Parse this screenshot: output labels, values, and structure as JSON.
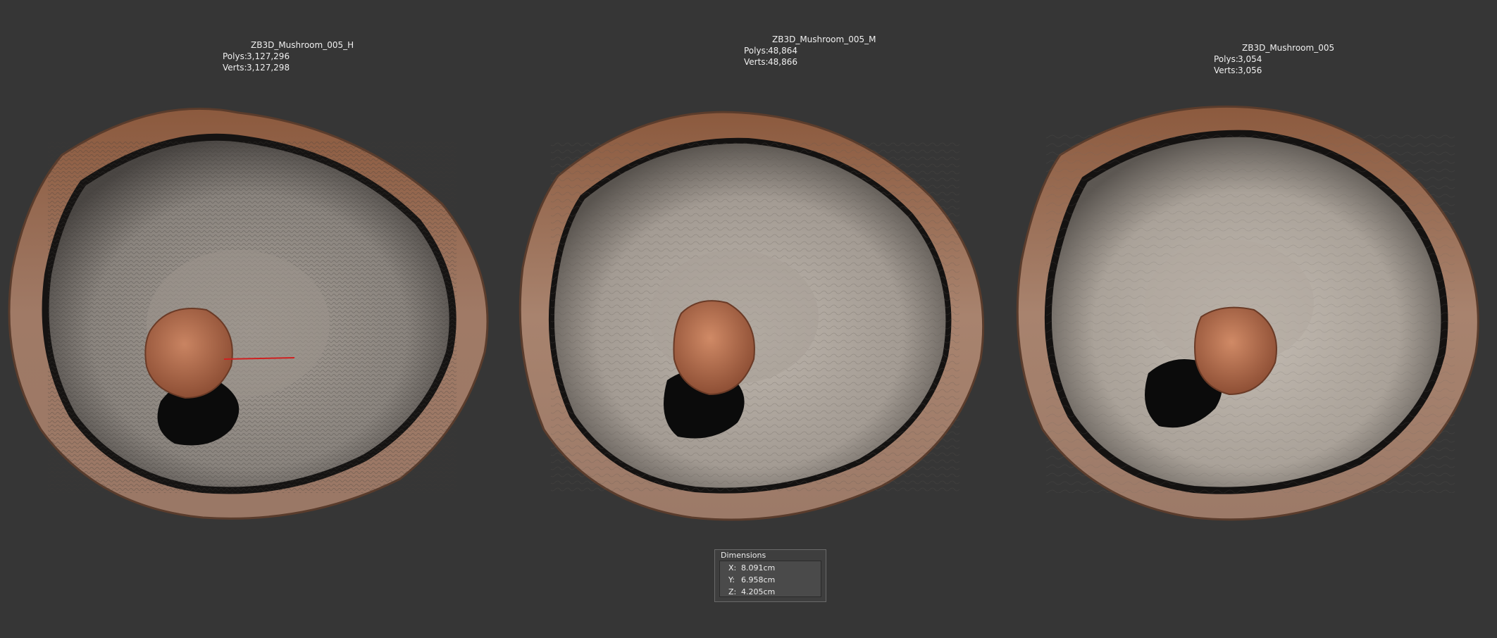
{
  "models": [
    {
      "name": "ZB3D_Mushroom_005_H",
      "polys_label": "Polys:",
      "polys": "3,127,296",
      "verts_label": "Verts:",
      "verts": "3,127,298"
    },
    {
      "name": "ZB3D_Mushroom_005_M",
      "polys_label": "Polys:",
      "polys": "48,864",
      "verts_label": "Verts:",
      "verts": "48,866"
    },
    {
      "name": "ZB3D_Mushroom_005",
      "polys_label": "Polys:",
      "polys": "3,054",
      "verts_label": "Verts:",
      "verts": "3,056"
    }
  ],
  "dimensions": {
    "title": "Dimensions",
    "x_label": "X:",
    "x": "8.091cm",
    "y_label": "Y:",
    "y": "6.958cm",
    "z_label": "Z:",
    "z": "4.205cm"
  },
  "colors": {
    "background": "#363636",
    "rim": "#8a6552",
    "gills_dark": "#6f6a65",
    "gills_light": "#b3aba2",
    "stem": "#b5704f",
    "shadow": "#0c0c0c"
  }
}
